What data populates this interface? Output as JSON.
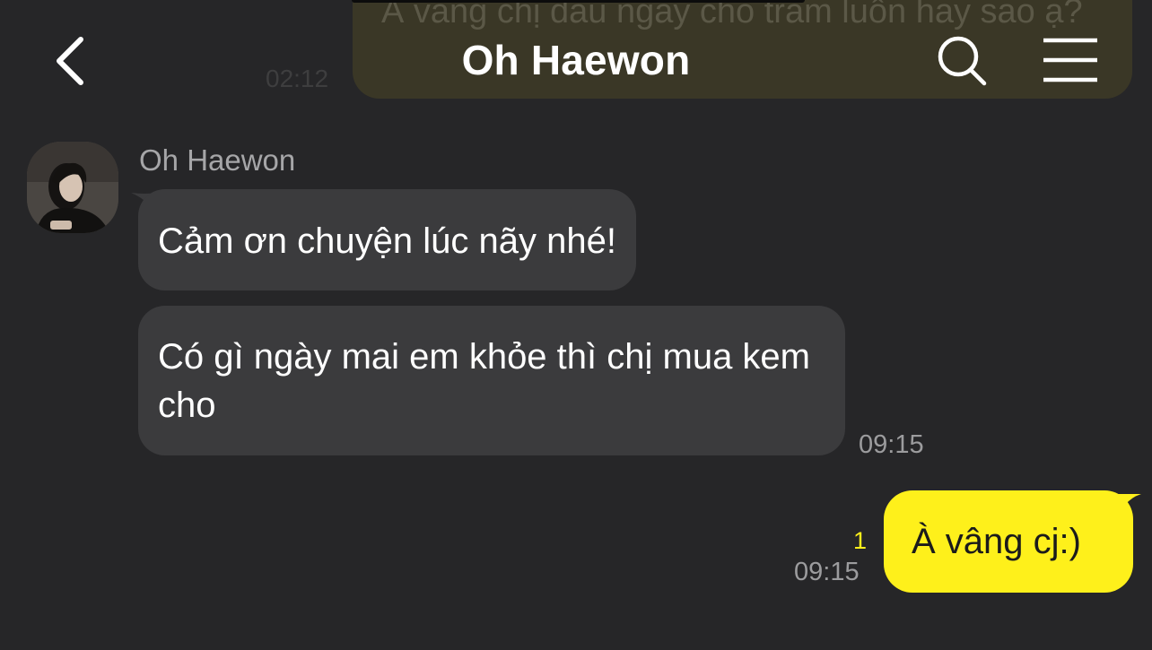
{
  "header": {
    "title": "Oh Haewon",
    "back_icon": "chevron-left-icon",
    "search_icon": "search-icon",
    "menu_icon": "hamburger-menu-icon"
  },
  "previous_message": {
    "text": "À vâng chị đau ngày cho trăm luôn hay sao ạ?",
    "time": "02:12"
  },
  "incoming": {
    "sender": "Oh Haewon",
    "messages": [
      "Cảm ơn chuyện lúc nãy nhé!",
      "Có gì ngày mai em khỏe thì chị mua kem cho"
    ],
    "time": "09:15"
  },
  "outgoing": {
    "text": "À vâng cj:)",
    "unread_count": "1",
    "time": "09:15"
  },
  "colors": {
    "background": "#262628",
    "incoming_bubble": "#3b3b3d",
    "outgoing_bubble": "#fef01b",
    "unread_count": "#fef01b",
    "secondary_text": "#9c9c9e"
  }
}
